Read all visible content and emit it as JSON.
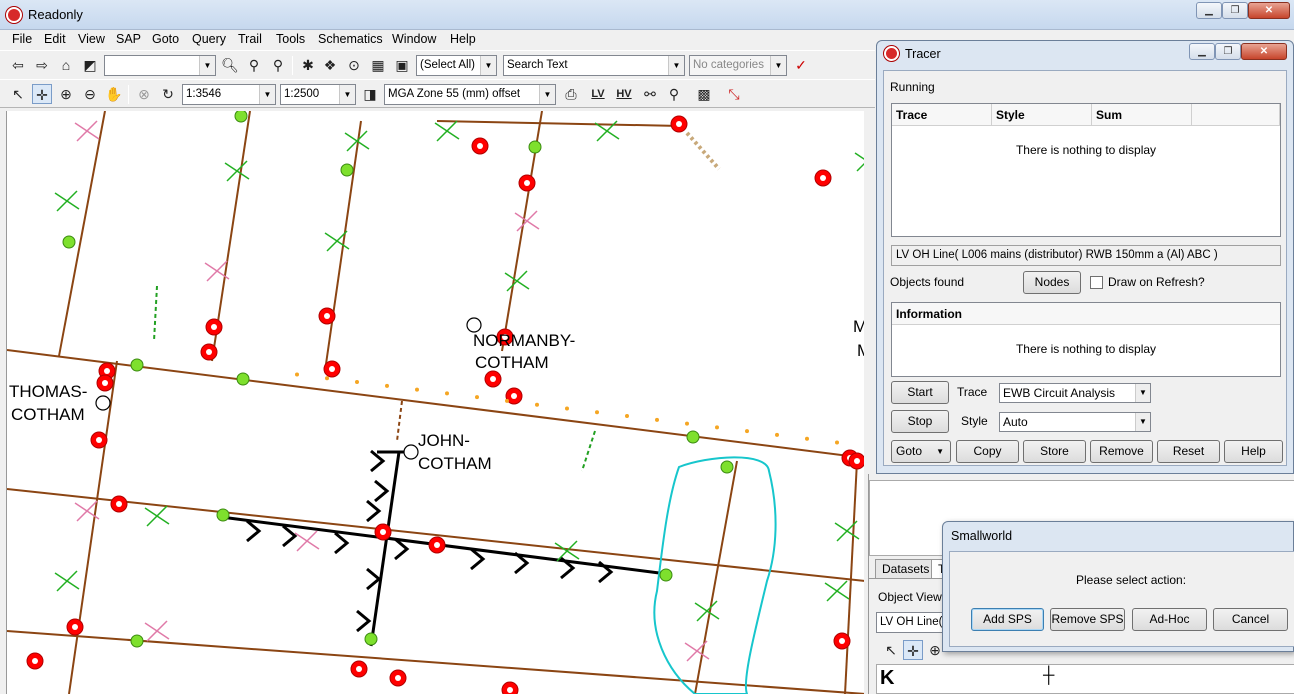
{
  "window": {
    "title": "Readonly"
  },
  "menu": [
    "File",
    "Edit",
    "View",
    "SAP",
    "Goto",
    "Query",
    "Trail",
    "Tools",
    "Schematics",
    "Window",
    "Help"
  ],
  "toolbar1": {
    "search_combo_value": "",
    "select_all": "(Select All)",
    "search_text": "Search Text",
    "categories": "No categories"
  },
  "toolbar2": {
    "scale_current": "1:3546",
    "scale_set": "1:2500",
    "projection": "MGA Zone 55 (mm) offset",
    "lv_label": "LV",
    "hv_label": "HV"
  },
  "map": {
    "labels": [
      "NORMANBY-",
      "COTHAM",
      "THOMAS-",
      "COTHAM",
      "JOHN-",
      "COTHAM",
      "M",
      "M"
    ]
  },
  "tracer": {
    "title": "Tracer",
    "status": "Running",
    "columns": [
      "Trace",
      "Style",
      "Sum"
    ],
    "empty_message": "There is nothing to display",
    "selected_object": "LV OH Line( L006 mains (distributor) RWB 150mm a (Al) ABC )",
    "objects_found_label": "Objects found",
    "nodes_button": "Nodes",
    "draw_on_refresh": "Draw on Refresh?",
    "information_header": "Information",
    "info_empty_message": "There is nothing to display",
    "start_button": "Start",
    "stop_button": "Stop",
    "trace_label": "Trace",
    "trace_value": "EWB Circuit Analysis",
    "style_label": "Style",
    "style_value": "Auto",
    "goto_button": "Goto",
    "copy_button": "Copy",
    "store_button": "Store",
    "remove_button": "Remove",
    "reset_button": "Reset",
    "help_button": "Help"
  },
  "lower_panel": {
    "tab_datasets": "Datasets",
    "tab_t": "T",
    "object_view_label": "Object View",
    "object_view_field": "LV OH Line("
  },
  "smallworld_dialog": {
    "title": "Smallworld",
    "prompt": "Please select action:",
    "buttons": [
      "Add SPS",
      "Remove SPS",
      "Ad-Hoc",
      "Cancel"
    ]
  }
}
